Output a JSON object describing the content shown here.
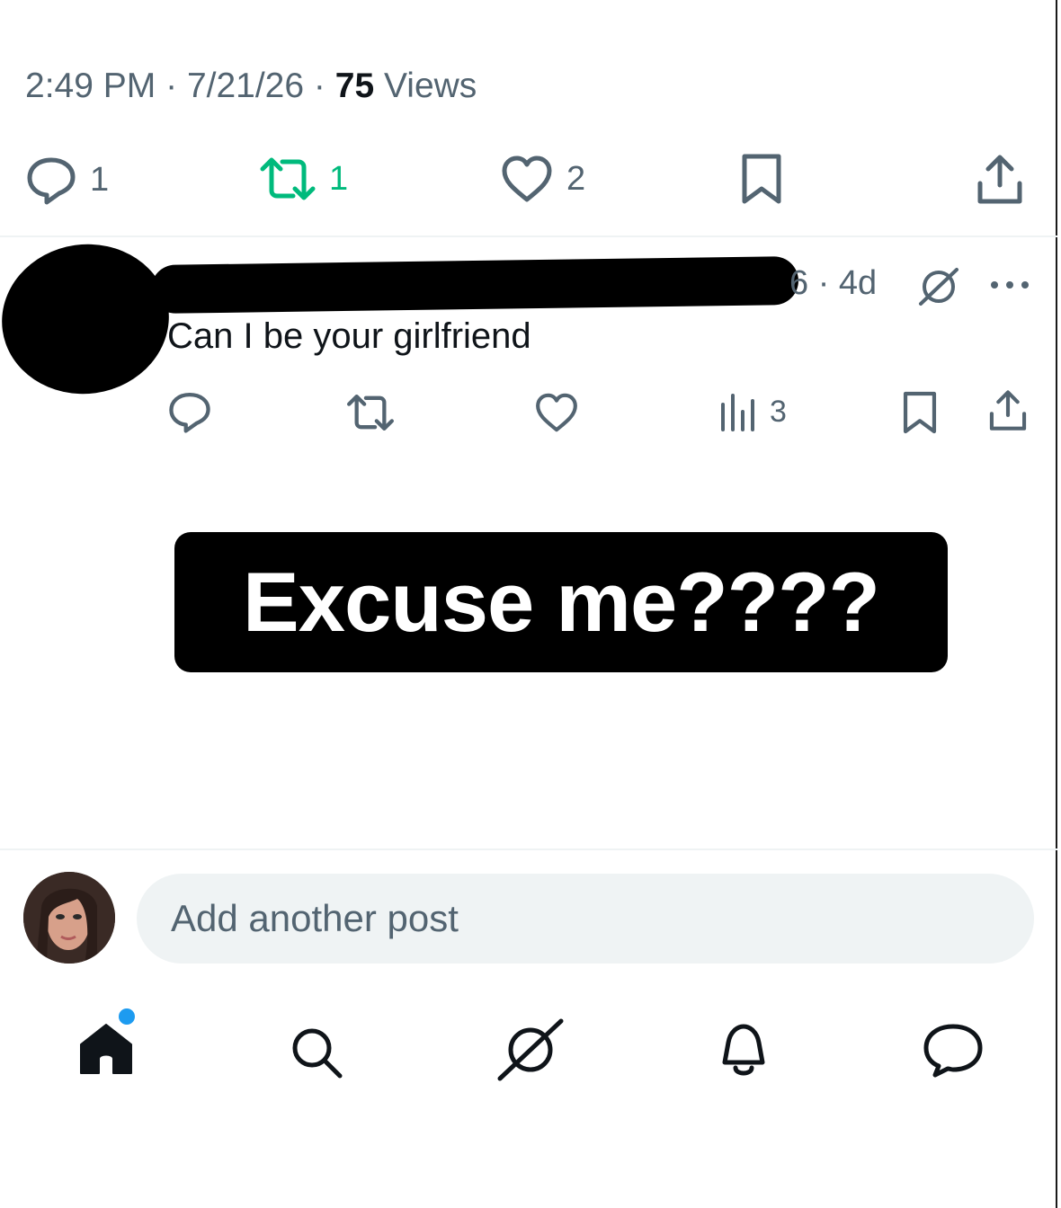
{
  "post": {
    "time": "2:49 PM",
    "date": "7/21/26",
    "views_count": "75",
    "views_label": "Views",
    "separator": "·"
  },
  "actions": {
    "reply_count": "1",
    "repost_count": "1",
    "like_count": "2"
  },
  "reply": {
    "meta_suffix": "6 · 4d",
    "text": "Can I be your girlfriend",
    "views_count": "3"
  },
  "overlay": {
    "caption": "Excuse me????"
  },
  "composer": {
    "placeholder": "Add another post"
  },
  "nav": {
    "items": [
      "home",
      "search",
      "grok",
      "notifications",
      "messages"
    ],
    "home_has_unread": true
  },
  "colors": {
    "text": "#0f1419",
    "muted": "#536471",
    "repost_active": "#00ba7c",
    "accent": "#1d9bf0",
    "composer_bg": "#eff3f4"
  }
}
